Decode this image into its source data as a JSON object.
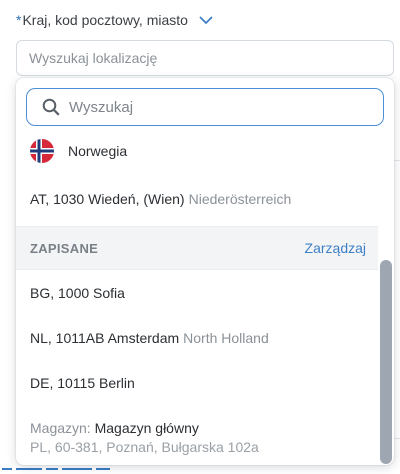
{
  "field": {
    "required_mark": "*",
    "label": "Kraj, kod pocztowy, miasto",
    "location_placeholder": "Wyszukaj lokalizację"
  },
  "dropdown": {
    "search_placeholder": "Wyszukaj",
    "results": [
      {
        "flag": "norway-flag",
        "label": "Norwegia"
      },
      {
        "main": "AT, 1030 Wiedeń, (Wien)",
        "region": "Niederösterreich"
      }
    ],
    "saved_section": {
      "title": "ZAPISANE",
      "manage_label": "Zarządzaj"
    },
    "saved": [
      {
        "main": "BG, 1000 Sofia",
        "region": ""
      },
      {
        "main": "NL, 1011AB Amsterdam",
        "region": "North Holland"
      },
      {
        "main": "DE, 10115 Berlin",
        "region": ""
      }
    ],
    "warehouse": {
      "prefix": "Magazyn:",
      "name": "Magazyn główny",
      "address": "PL, 60-381, Poznań, Bułgarska 102a"
    }
  },
  "colors": {
    "accent": "#3d7fc7",
    "focus_border": "#4d8fd6",
    "section_bg": "#f3f4f6",
    "scroll_thumb": "#9ea7b1"
  }
}
